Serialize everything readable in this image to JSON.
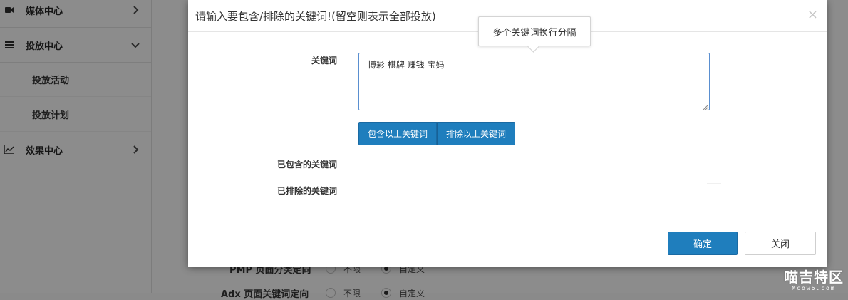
{
  "sidebar": {
    "items": [
      {
        "label": "媒体中心",
        "icon": "video-camera-icon"
      },
      {
        "label": "投放中心",
        "icon": "list-icon"
      },
      {
        "label": "效果中心",
        "icon": "line-chart-icon"
      }
    ],
    "subitems": [
      {
        "label": "投放活动"
      },
      {
        "label": "投放计划"
      }
    ]
  },
  "background": {
    "row1_label": "PMP 页面分类定向",
    "row1_opt1": "不限",
    "row1_opt2": "自定义",
    "row2_label": "Adx 页面关键词定向",
    "row2_opt1": "不限",
    "row2_opt2": "自定义"
  },
  "modal": {
    "title": "请输入要包含/排除的关键词!(留空则表示全部投放)",
    "close_glyph": "×",
    "tooltip": "多个关键词换行分隔",
    "keyword_label": "关键词",
    "keyword_value": "博彩 棋牌 赚钱 宝妈",
    "include_button": "包含以上关键词",
    "exclude_button": "排除以上关键词",
    "included_label": "已包含的关键词",
    "excluded_label": "已排除的关键词",
    "confirm_button": "确定",
    "close_button": "关闭"
  },
  "watermark": {
    "main": "喵吉特区",
    "sub": "Mcow6.com"
  },
  "colors": {
    "primary": "#1f7ebd",
    "overlay_bg": "#8c8c8c",
    "input_focus_border": "#5a8fd0"
  }
}
